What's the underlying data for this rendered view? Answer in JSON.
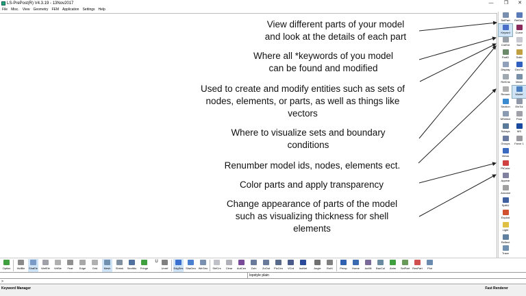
{
  "window": {
    "title": "LS-PrePost(R) V4.3.19 - 13Nov2017",
    "buttons": [
      "—",
      "❐",
      "✕"
    ]
  },
  "menu": [
    "File",
    "Misc.",
    "View",
    "Geometry",
    "FEM",
    "Application",
    "Settings",
    "Help"
  ],
  "annotations": [
    {
      "id": "view-parts",
      "lines": [
        "View different parts of your model",
        "and look at the details of each part"
      ]
    },
    {
      "id": "keywords",
      "lines": [
        "Where all *keywords of you model",
        "can be found and modified"
      ]
    },
    {
      "id": "sets",
      "lines": [
        "Used to create and modify entities such as sets of",
        "nodes, elements, or parts, as well as things like",
        "vectors"
      ]
    },
    {
      "id": "boundary",
      "lines": [
        "Where to visualize sets and boundary",
        "conditions"
      ]
    },
    {
      "id": "renumber",
      "lines": [
        "Renumber model ids, nodes, elements ect."
      ]
    },
    {
      "id": "color",
      "lines": [
        "Color parts and apply transparency"
      ]
    },
    {
      "id": "appearance",
      "lines": [
        "Change appearance of parts of the model",
        "such as visualizing thickness for shell",
        "elements"
      ]
    }
  ],
  "right_panel": [
    {
      "label": "SelPart",
      "icon": "select-part-icon",
      "color": "#7a8fb0"
    },
    {
      "label": "RefGeo",
      "icon": "ref-geometry-icon",
      "color": "#5a7ab8"
    },
    {
      "label": "Keywrd",
      "icon": "keyword-icon",
      "color": "#4a6fc8",
      "active": true
    },
    {
      "label": "Curve",
      "icon": "curve-icon",
      "color": "#8a2a5a"
    },
    {
      "label": "CreEnt",
      "icon": "create-entity-icon",
      "color": "#9aa0a8"
    },
    {
      "label": "Surf",
      "icon": "surface-icon",
      "color": "#c8c8d0"
    },
    {
      "label": "PartD",
      "icon": "part-data-icon",
      "color": "#6a8a6a"
    },
    {
      "label": "Solid",
      "icon": "solid-icon",
      "color": "#c0a040"
    },
    {
      "label": "Display",
      "icon": "display-icon",
      "color": "#8fa0b8"
    },
    {
      "label": "GeoTol",
      "icon": "geo-tolerance-icon",
      "color": "#3060c0"
    },
    {
      "label": "RefChk",
      "icon": "ref-check-icon",
      "color": "#a0a8b0"
    },
    {
      "label": "Mesh",
      "icon": "mesh-icon",
      "color": "#7890a8"
    },
    {
      "label": "Renum",
      "icon": "renumber-icon",
      "color": "#b0b0b0"
    },
    {
      "label": "Model",
      "icon": "model-icon",
      "color": "#4a80c0",
      "active": true
    },
    {
      "label": "Section",
      "icon": "section-icon",
      "color": "#3a8ad0"
    },
    {
      "label": "EleTol",
      "icon": "element-tools-icon",
      "color": "#9098a8"
    },
    {
      "label": "MSelect",
      "icon": "model-select-icon",
      "color": "#8a9ab0"
    },
    {
      "label": "Post",
      "icon": "post-icon",
      "color": "#a0a0a8"
    },
    {
      "label": "Subsys",
      "icon": "subsystem-icon",
      "color": "#5a7a9a"
    },
    {
      "label": "MS",
      "icon": "ms-icon",
      "color": "#1a4aa0"
    },
    {
      "label": "Groups",
      "icon": "groups-icon",
      "color": "#6a7aa0"
    },
    {
      "label": "Favor 1",
      "icon": "favorite-icon",
      "color": "#9a9aa0"
    },
    {
      "label": "Views",
      "icon": "views-icon",
      "color": "#3a6ac0"
    },
    {
      "label": "PtColor",
      "icon": "part-color-icon",
      "color": "#d04040"
    },
    {
      "label": "Appear",
      "icon": "appearance-icon",
      "color": "#8080a0"
    },
    {
      "label": "Annotat",
      "icon": "annotate-icon",
      "color": "#a0a0a0"
    },
    {
      "label": "SplitU",
      "icon": "split-icon",
      "color": "#4060a0"
    },
    {
      "label": "Explod",
      "icon": "explode-icon",
      "color": "#d05030"
    },
    {
      "label": "Light",
      "icon": "light-icon",
      "color": "#e0c040"
    },
    {
      "label": "Reflect",
      "icon": "reflect-icon",
      "color": "#6080a0"
    },
    {
      "label": "Trace",
      "icon": "trace-icon",
      "color": "#7090b0"
    }
  ],
  "bottom_toolbar": [
    {
      "label": "Option",
      "icon": "option-icon",
      "color": "#40a040"
    },
    {
      "label": "HidBle",
      "icon": "hidden-icon",
      "color": "#8a8a8a"
    },
    {
      "label": "ShaEle",
      "icon": "shade-icon",
      "color": "#7a9ac8",
      "active": true
    },
    {
      "label": "WefEle",
      "icon": "wireframe-icon",
      "color": "#a0a0a8"
    },
    {
      "label": "WrBle",
      "icon": "wire-icon",
      "color": "#b0b0b0"
    },
    {
      "label": "Feat",
      "icon": "feature-icon",
      "color": "#909090"
    },
    {
      "label": "Edge",
      "icon": "edge-icon",
      "color": "#a8a8a8"
    },
    {
      "label": "Grid",
      "icon": "grid-icon",
      "color": "#b0b0b0"
    },
    {
      "label": "Mesh",
      "icon": "mesh-icon",
      "color": "#7090b0",
      "active": true
    },
    {
      "label": "Shrink",
      "icon": "shrink-icon",
      "color": "#8090a0"
    },
    {
      "label": "SectMo",
      "icon": "section-mode-icon",
      "color": "#5070a0"
    },
    {
      "label": "Fringe",
      "icon": "fringe-icon",
      "color": "#40a040"
    },
    {
      "label": "U",
      "icon": "u-icon",
      "color": "#606060"
    },
    {
      "label": "Unref",
      "icon": "unref-icon",
      "color": "#808080"
    },
    {
      "label": "EdgSes",
      "icon": "edge-sets-icon",
      "color": "#3a70d0",
      "active": true
    },
    {
      "label": "ShaGeo",
      "icon": "shade-geo-icon",
      "color": "#4a80d0"
    },
    {
      "label": "WirGeo",
      "icon": "wire-geo-icon",
      "color": "#7a90b0"
    },
    {
      "label": "ShfCrs",
      "icon": "shift-cross-icon",
      "color": "#c0c0c8"
    },
    {
      "label": "Clear",
      "icon": "clear-icon",
      "color": "#b0b0b8"
    },
    {
      "label": "AutCen",
      "icon": "auto-center-icon",
      "color": "#7a4a9a"
    },
    {
      "label": "ZoIn",
      "icon": "zoom-in-icon",
      "color": "#6a7a9a"
    },
    {
      "label": "ZoOut",
      "icon": "zoom-out-icon",
      "color": "#6a7a9a"
    },
    {
      "label": "PicCen",
      "icon": "pick-center-icon",
      "color": "#5a6a8a"
    },
    {
      "label": "VCrd",
      "icon": "view-coord-icon",
      "color": "#4a5a8a"
    },
    {
      "label": "IsoNet",
      "icon": "isometric-icon",
      "color": "#2a4a9a"
    },
    {
      "label": "Angle",
      "icon": "angle-icon",
      "color": "#707070"
    },
    {
      "label": "RotX",
      "icon": "rotate-icon",
      "color": "#808080"
    },
    {
      "label": "Persp",
      "icon": "perspective-icon",
      "color": "#3060b0"
    },
    {
      "label": "Home",
      "icon": "home-icon",
      "color": "#3a6ab0"
    },
    {
      "label": "AcMll",
      "icon": "acmll-icon",
      "color": "#7a6a9a"
    },
    {
      "label": "BacCol",
      "icon": "background-color-icon",
      "color": "#6a8aa0"
    },
    {
      "label": "Anim",
      "icon": "animate-icon",
      "color": "#40a040"
    },
    {
      "label": "SelPart",
      "icon": "select-part-icon",
      "color": "#6a9a5a"
    },
    {
      "label": "ResPart",
      "icon": "reset-part-icon",
      "color": "#d05050"
    },
    {
      "label": "Plot",
      "icon": "plot-icon",
      "color": "#6a8ab0"
    }
  ],
  "command": {
    "message": "lopstyle plain",
    "prompt": ">"
  },
  "status": {
    "left": "Keyword Manager",
    "right": "Fast Renderer"
  }
}
